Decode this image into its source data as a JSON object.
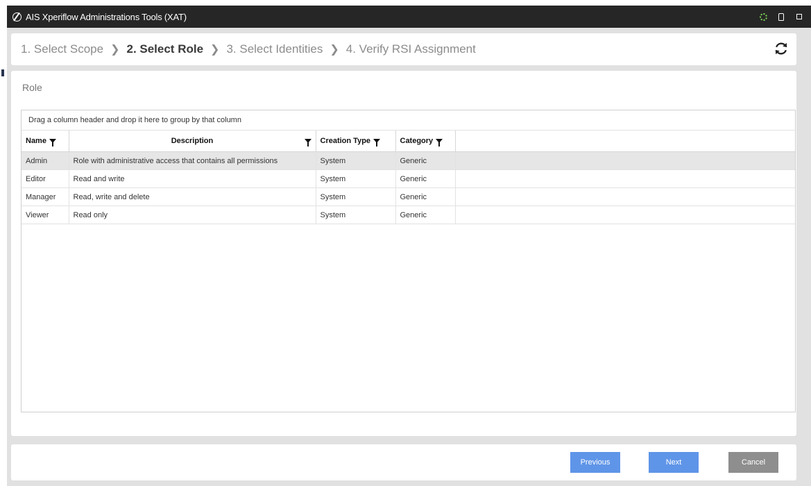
{
  "window": {
    "title": "AIS Xperiflow Administrations Tools (XAT)"
  },
  "wizard": {
    "steps": [
      {
        "label": "1. Select Scope",
        "active": false
      },
      {
        "label": "2. Select Role",
        "active": true
      },
      {
        "label": "3. Select Identities",
        "active": false
      },
      {
        "label": "4. Verify RSI Assignment",
        "active": false
      }
    ]
  },
  "section": {
    "label": "Role"
  },
  "grid": {
    "group_panel_text": "Drag a column header and drop it here to group by that column",
    "columns": [
      "Name",
      "Description",
      "Creation Type",
      "Category"
    ],
    "rows": [
      {
        "name": "Admin",
        "description": "Role with administrative access that contains all permissions",
        "creation_type": "System",
        "category": "Generic",
        "selected": true
      },
      {
        "name": "Editor",
        "description": "Read and write",
        "creation_type": "System",
        "category": "Generic",
        "selected": false
      },
      {
        "name": "Manager",
        "description": "Read, write and delete",
        "creation_type": "System",
        "category": "Generic",
        "selected": false
      },
      {
        "name": "Viewer",
        "description": "Read only",
        "creation_type": "System",
        "category": "Generic",
        "selected": false
      }
    ]
  },
  "footer": {
    "previous_label": "Previous",
    "next_label": "Next",
    "cancel_label": "Cancel"
  },
  "colors": {
    "titlebar": "#262626",
    "primary_button": "#5f95e8",
    "cancel_button": "#8e8e8e",
    "selected_row": "#e6e6e6"
  }
}
